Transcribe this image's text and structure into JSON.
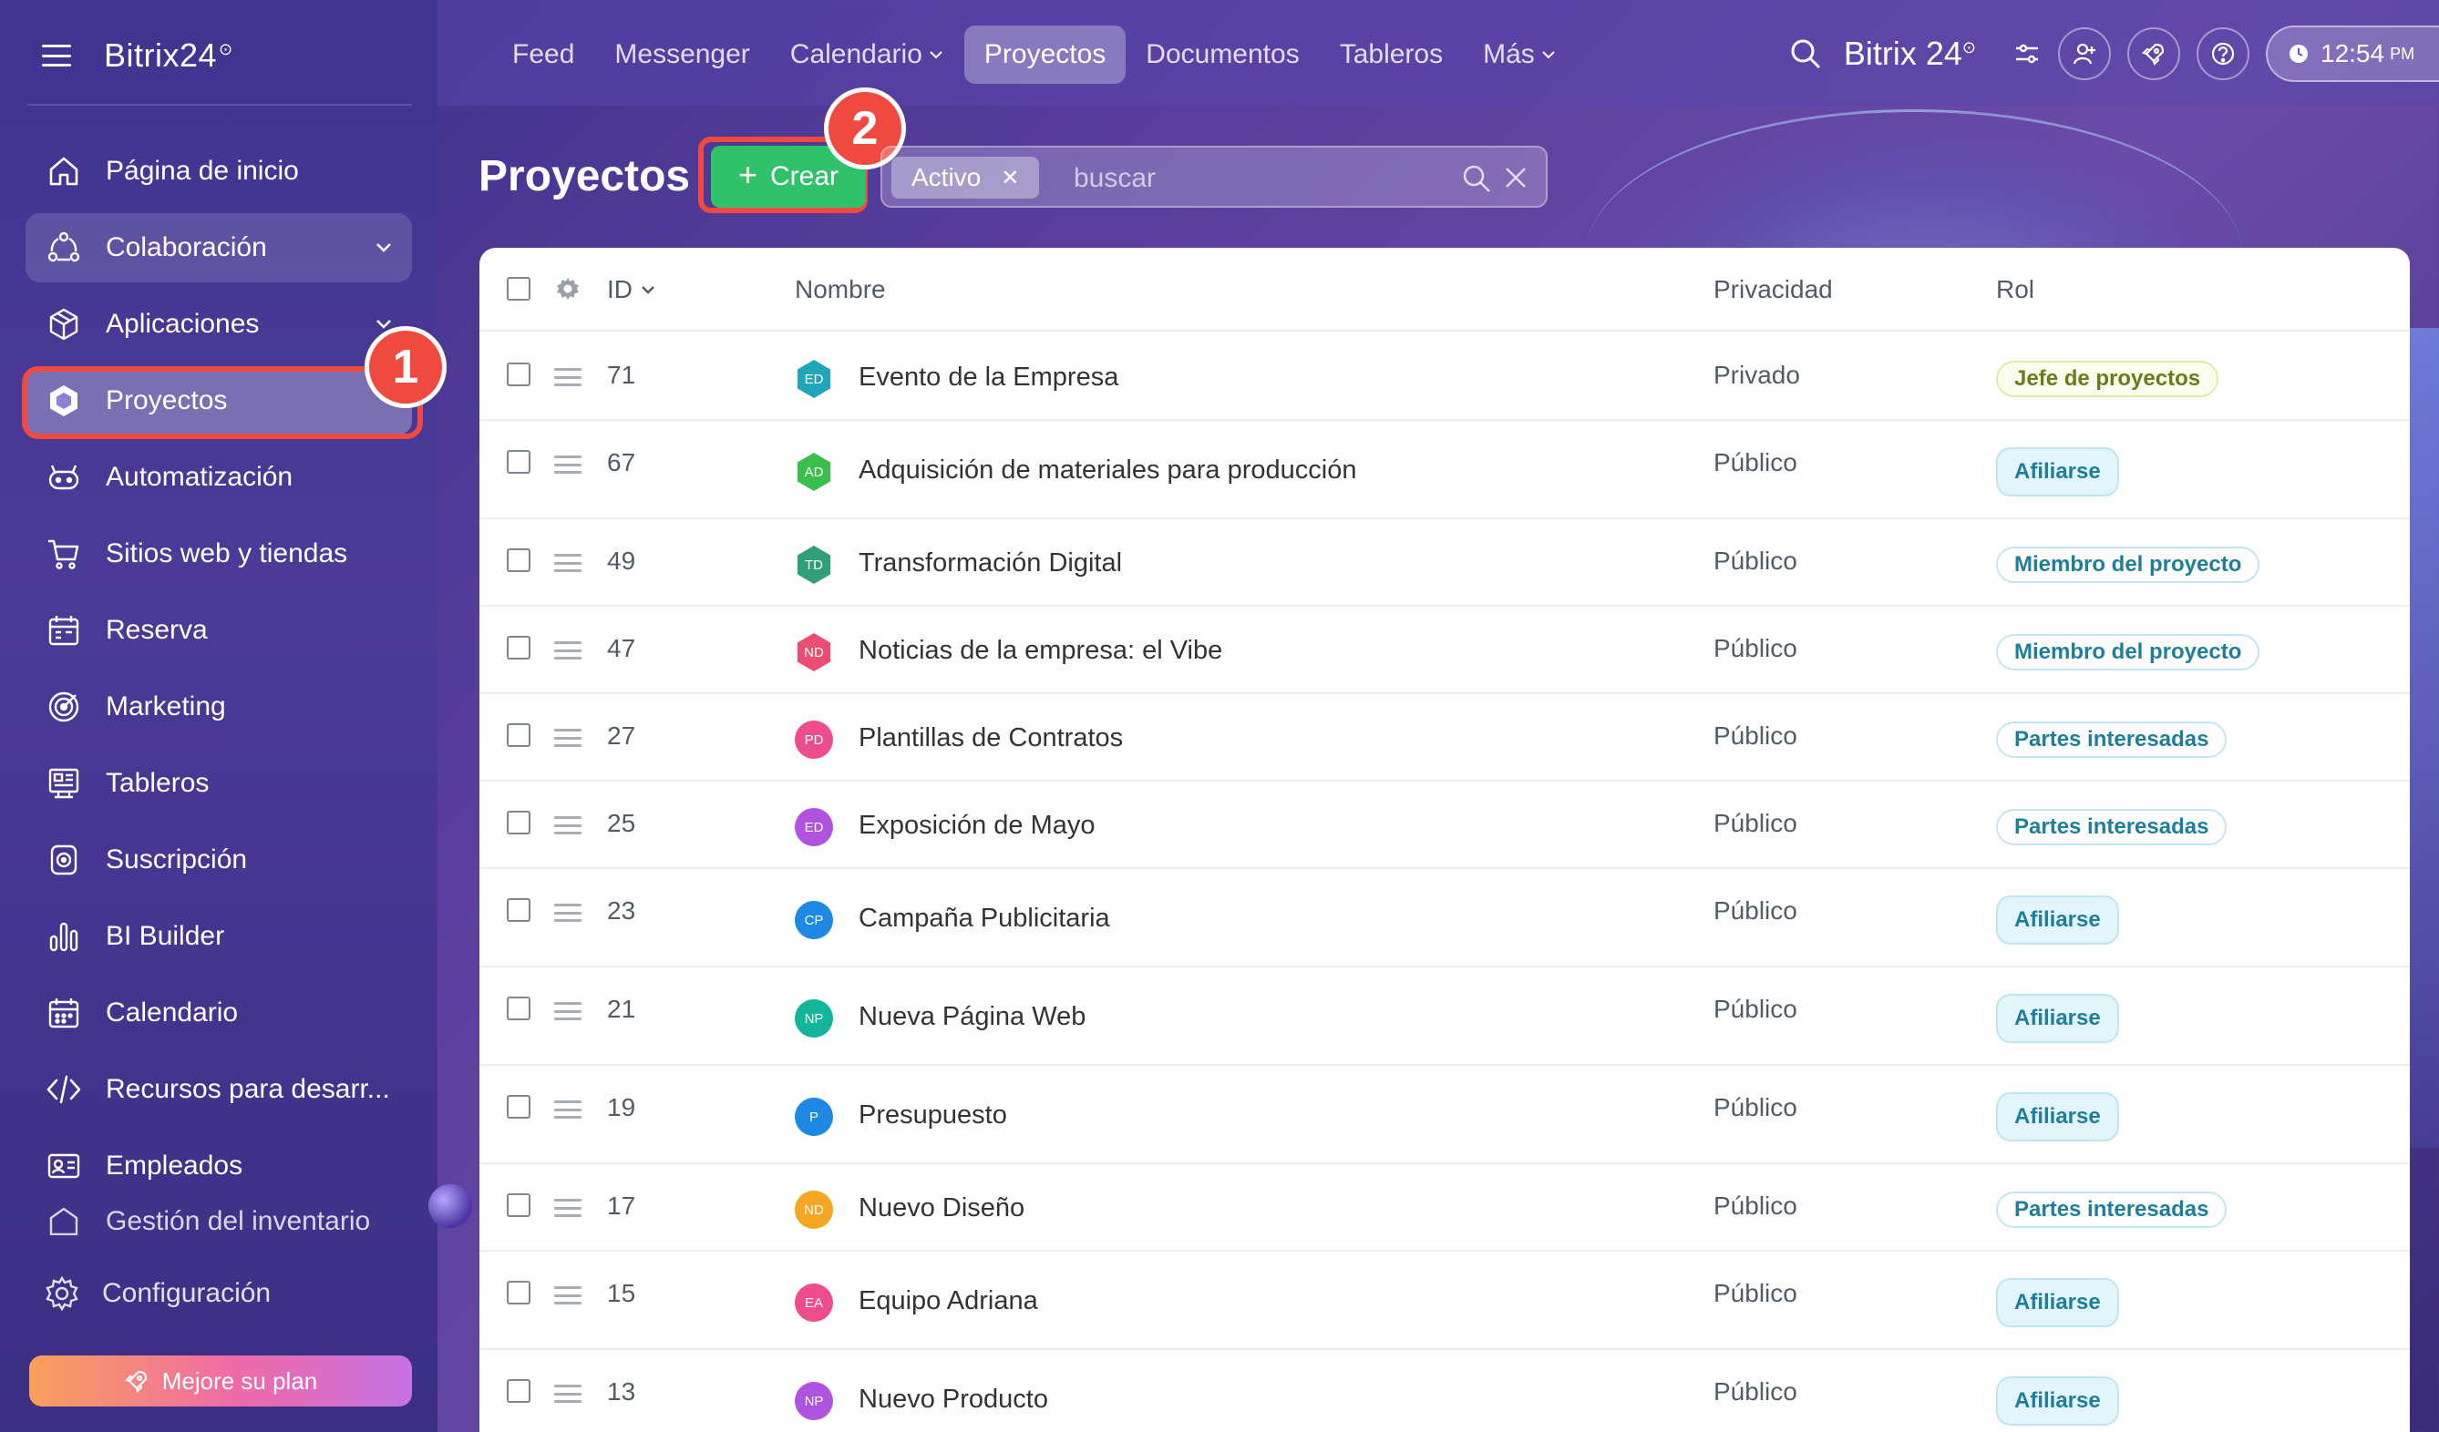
{
  "sidebar": {
    "brand": "Bitrix24",
    "items": [
      {
        "label": "Página de inicio",
        "icon": "home-icon"
      },
      {
        "label": "Colaboración",
        "icon": "collaboration-icon"
      },
      {
        "label": "Aplicaciones",
        "icon": "apps-cube-icon"
      },
      {
        "label": "Proyectos",
        "icon": "projects-hexagon-icon"
      },
      {
        "label": "Automatización",
        "icon": "automation-robot-icon"
      },
      {
        "label": "Sitios web y tiendas",
        "icon": "cart-icon"
      },
      {
        "label": "Reserva",
        "icon": "booking-calendar-icon"
      },
      {
        "label": "Marketing",
        "icon": "marketing-target-icon"
      },
      {
        "label": "Tableros",
        "icon": "boards-icon"
      },
      {
        "label": "Suscripción",
        "icon": "subscription-icon"
      },
      {
        "label": "BI Builder",
        "icon": "bi-chart-icon"
      },
      {
        "label": "Calendario",
        "icon": "calendar-icon"
      },
      {
        "label": "Recursos para desarr...",
        "icon": "code-icon"
      },
      {
        "label": "Empleados",
        "icon": "employees-icon"
      },
      {
        "label": "Gestión del inventario",
        "icon": "inventory-icon"
      }
    ],
    "settings": "Configuración",
    "upgrade": "Mejore su plan"
  },
  "annotations": {
    "step1": "1",
    "step2": "2"
  },
  "topbar": {
    "nav": [
      {
        "label": "Feed"
      },
      {
        "label": "Messenger"
      },
      {
        "label": "Calendario"
      },
      {
        "label": "Proyectos"
      },
      {
        "label": "Documentos"
      },
      {
        "label": "Tableros"
      },
      {
        "label": "Más"
      }
    ],
    "brand": "Bitrix 24",
    "time": "12:54",
    "ampm": "PM"
  },
  "toolbar": {
    "title": "Proyectos",
    "create": "Crear",
    "filter_chip": "Activo",
    "search_placeholder": "buscar"
  },
  "table": {
    "headers": {
      "id": "ID",
      "name": "Nombre",
      "privacy": "Privacidad",
      "role": "Rol"
    },
    "rows": [
      {
        "id": "71",
        "initials": "ED",
        "name": "Evento de la Empresa",
        "privacy": "Privado",
        "role": "Jefe de proyectos",
        "role_type": "lead",
        "av_color": "#1fa6b8",
        "shape": "hex"
      },
      {
        "id": "67",
        "initials": "AD",
        "name": "Adquisición de materiales para producción",
        "privacy": "Público",
        "role": "Afiliarse",
        "role_type": "join",
        "av_color": "#3bbf4b",
        "shape": "hex"
      },
      {
        "id": "49",
        "initials": "TD",
        "name": "Transformación Digital",
        "privacy": "Público",
        "role": "Miembro del proyecto",
        "role_type": "member",
        "av_color": "#2f9e79",
        "shape": "hex"
      },
      {
        "id": "47",
        "initials": "ND",
        "name": "Noticias de la empresa: el Vibe",
        "privacy": "Público",
        "role": "Miembro del proyecto",
        "role_type": "member",
        "av_color": "#ee4d73",
        "shape": "hex"
      },
      {
        "id": "27",
        "initials": "PD",
        "name": "Plantillas de Contratos",
        "privacy": "Público",
        "role": "Partes interesadas",
        "role_type": "member",
        "av_color": "#ee4d8c",
        "shape": "circ"
      },
      {
        "id": "25",
        "initials": "ED",
        "name": "Exposición de Mayo",
        "privacy": "Público",
        "role": "Partes interesadas",
        "role_type": "member",
        "av_color": "#b053e0",
        "shape": "circ"
      },
      {
        "id": "23",
        "initials": "CP",
        "name": "Campaña Publicitaria",
        "privacy": "Público",
        "role": "Afiliarse",
        "role_type": "join",
        "av_color": "#1e88e5",
        "shape": "circ"
      },
      {
        "id": "21",
        "initials": "NP",
        "name": "Nueva Página Web",
        "privacy": "Público",
        "role": "Afiliarse",
        "role_type": "join",
        "av_color": "#12b59a",
        "shape": "circ"
      },
      {
        "id": "19",
        "initials": "P",
        "name": "Presupuesto",
        "privacy": "Público",
        "role": "Afiliarse",
        "role_type": "join",
        "av_color": "#1e88e5",
        "shape": "circ"
      },
      {
        "id": "17",
        "initials": "ND",
        "name": "Nuevo Diseño",
        "privacy": "Público",
        "role": "Partes interesadas",
        "role_type": "member",
        "av_color": "#f5a623",
        "shape": "circ"
      },
      {
        "id": "15",
        "initials": "EA",
        "name": "Equipo Adriana",
        "privacy": "Público",
        "role": "Afiliarse",
        "role_type": "join",
        "av_color": "#ee4d8c",
        "shape": "circ"
      },
      {
        "id": "13",
        "initials": "NP",
        "name": "Nuevo Producto",
        "privacy": "Público",
        "role": "Afiliarse",
        "role_type": "join",
        "av_color": "#b053e0",
        "shape": "circ"
      }
    ]
  },
  "colors": {
    "accent_green": "#2fc26b",
    "highlight_red": "#f0493f"
  }
}
